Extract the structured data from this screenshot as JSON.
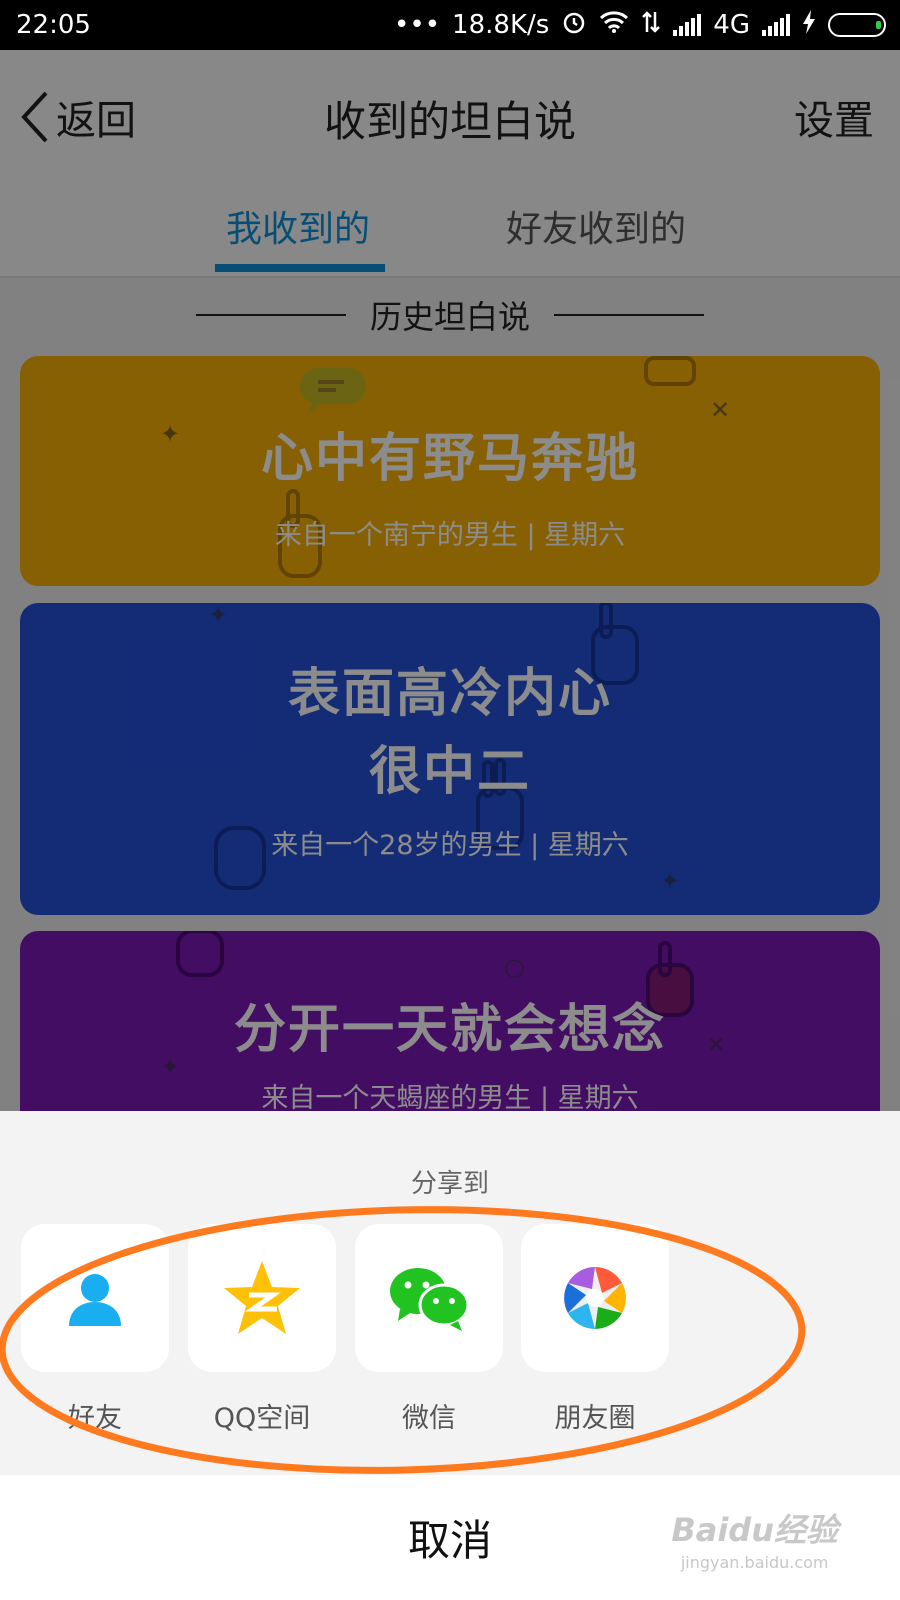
{
  "status_bar": {
    "time": "22:05",
    "dots": "•••",
    "speed": "18.8K/s",
    "network": "4G"
  },
  "header": {
    "back_label": "返回",
    "title": "收到的坦白说",
    "settings_label": "设置"
  },
  "tabs": [
    {
      "label": "我收到的",
      "active": true
    },
    {
      "label": "好友收到的",
      "active": false
    }
  ],
  "section_heading": "历史坦白说",
  "cards": [
    {
      "title": "心中有野马奔驰",
      "subtitle": "来自一个南宁的男生 | 星期六",
      "color": "#f6b007"
    },
    {
      "title_line1": "表面高冷内心",
      "title_line2": "很中二",
      "subtitle": "来自一个28岁的男生 | 星期六",
      "color": "#2550d8"
    },
    {
      "title": "分开一天就会想念",
      "subtitle": "来自一个天蝎座的男生 | 星期六",
      "color": "#7a18b5"
    }
  ],
  "share_sheet": {
    "title": "分享到",
    "items": [
      {
        "label": "好友",
        "icon": "qq-friend-icon"
      },
      {
        "label": "QQ空间",
        "icon": "qzone-star-icon"
      },
      {
        "label": "微信",
        "icon": "wechat-icon"
      },
      {
        "label": "朋友圈",
        "icon": "moments-aperture-icon"
      }
    ],
    "cancel_label": "取消"
  },
  "annotation_color": "#ff7a1f",
  "watermark": {
    "main": "Baidu经验",
    "sub": "jingyan.baidu.com"
  }
}
